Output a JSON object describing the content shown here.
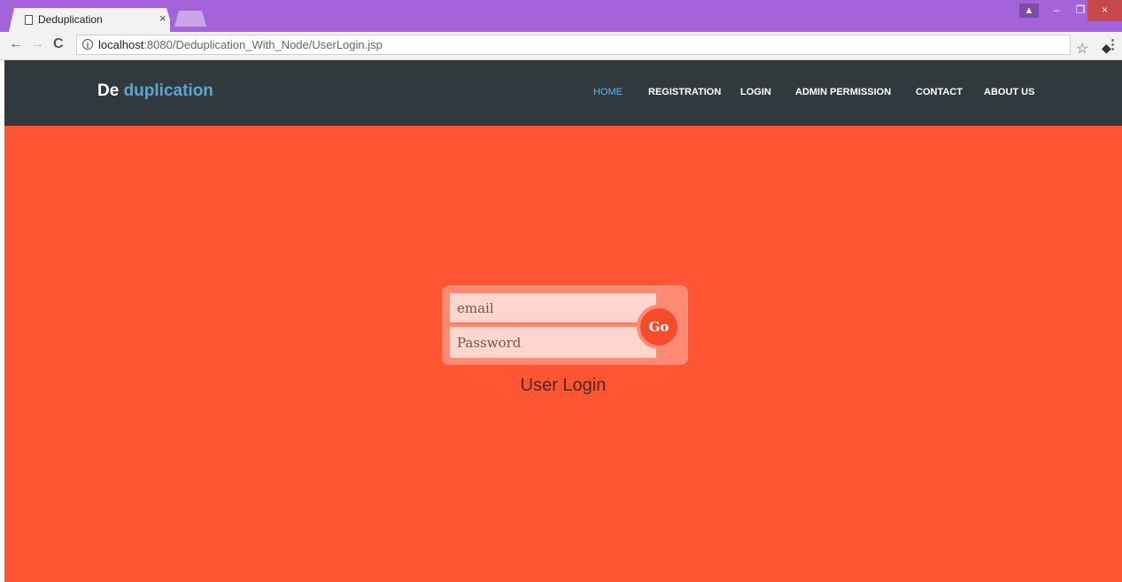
{
  "browser": {
    "tab_title": "Deduplication",
    "tab_close": "×",
    "url_host": "localhost",
    "url_rest": ":8080/Deduplication_With_Node/UserLogin.jsp",
    "back": "←",
    "forward": "→",
    "reload": "C",
    "info": "i",
    "star": "☆",
    "eraser": "◆",
    "extension": "+",
    "menu": "⋮",
    "user": "▲",
    "minimize": "–",
    "maximize": "❐",
    "close": "×"
  },
  "header": {
    "brand_part1": "De",
    "brand_part2": "duplication",
    "brand_accent_color": "#60a5d2",
    "background_color": "#2f393e"
  },
  "nav": {
    "items": [
      {
        "label": "HOME",
        "active": true
      },
      {
        "label": "REGISTRATION",
        "active": false
      },
      {
        "label": "LOGIN",
        "active": false
      },
      {
        "label": "ADMIN PERMISSION",
        "active": false
      },
      {
        "label": "CONTACT",
        "active": false
      },
      {
        "label": "ABOUT US",
        "active": false
      }
    ]
  },
  "login": {
    "email_placeholder": "email",
    "password_placeholder": "Password",
    "email_value": "",
    "password_value": "",
    "go_label": "Go",
    "caption": "User Login",
    "page_color": "#ff5533"
  }
}
